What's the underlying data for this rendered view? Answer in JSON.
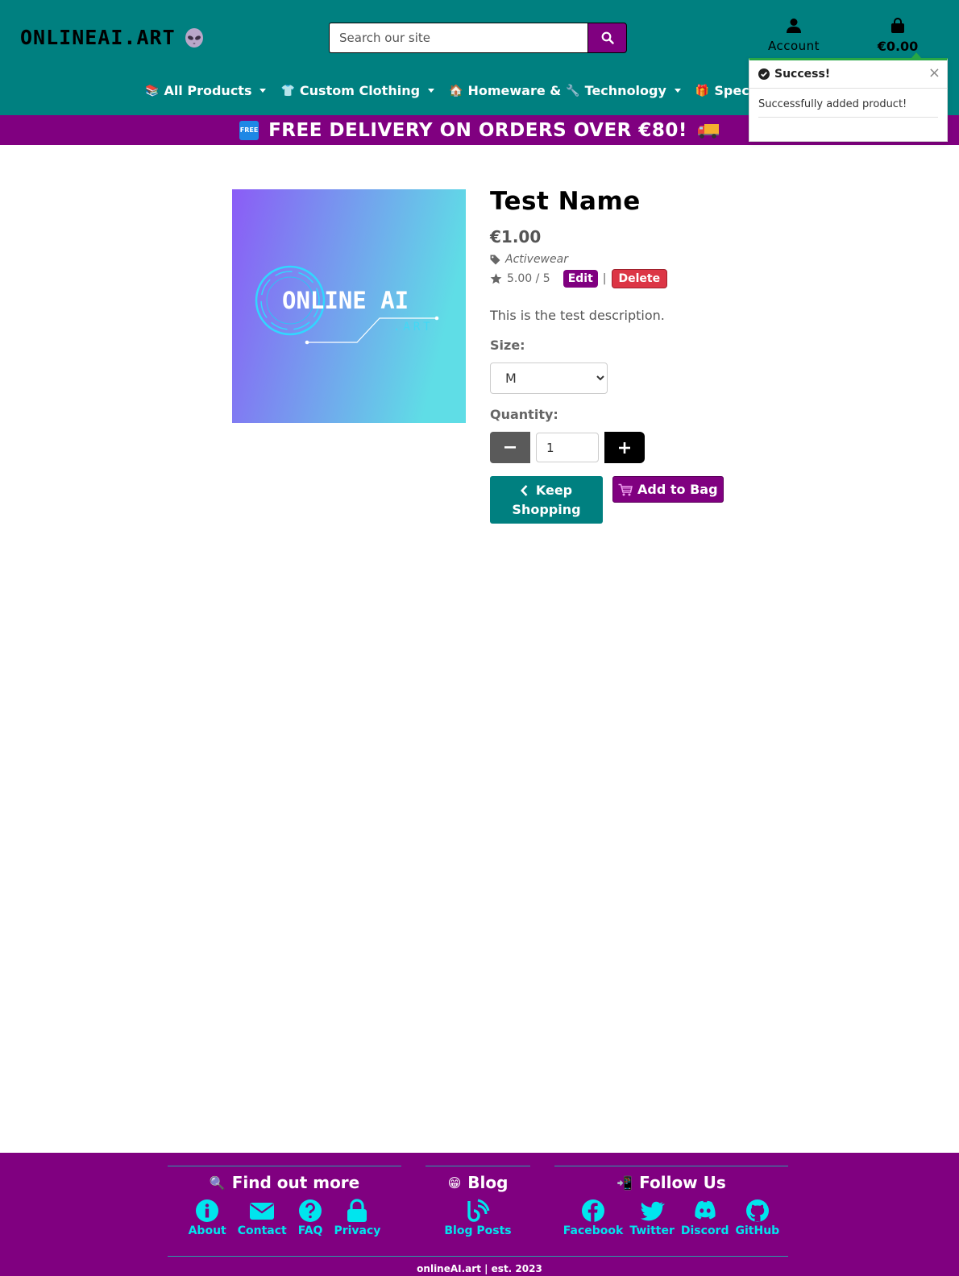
{
  "header": {
    "logo_text": "ONLINEAI.ART",
    "search_placeholder": "Search our site",
    "account_label": "Account",
    "cart_total": "€0.00"
  },
  "nav": {
    "items": [
      {
        "emoji": "📚",
        "label": "All Products"
      },
      {
        "emoji": "👕",
        "label": "Custom Clothing"
      },
      {
        "emoji": "🏠",
        "label": "Homeware &"
      },
      {
        "emoji": "🔧",
        "label": "Technology"
      },
      {
        "emoji": "🎁",
        "label": "Spec"
      }
    ]
  },
  "banner": {
    "badge": "FREE",
    "text": "FREE DELIVERY ON ORDERS OVER €80!"
  },
  "toast": {
    "title": "Success!",
    "close": "×",
    "message": "Successfully added product!"
  },
  "product": {
    "image_text": "ONLINE AI",
    "image_subtext": ".ART",
    "name": "Test Name",
    "price": "€1.00",
    "category": "Activewear",
    "rating": "5.00 / 5",
    "edit_label": "Edit",
    "separator": "|",
    "delete_label": "Delete",
    "description": "This is the test description.",
    "size_label": "Size:",
    "size_value": "M",
    "quantity_label": "Quantity:",
    "quantity_value": "1",
    "keep_line1": "Keep",
    "keep_line2": "Shopping",
    "add_label": "Add to Bag"
  },
  "footer": {
    "find": {
      "emoji": "🔍",
      "title": "Find out more",
      "links": [
        "About",
        "Contact",
        "FAQ",
        "Privacy"
      ]
    },
    "blog": {
      "emoji": "😁",
      "title": "Blog",
      "links": [
        "Blog",
        "Posts"
      ]
    },
    "follow": {
      "emoji": "📲",
      "title": "Follow Us",
      "links": [
        "Facebook",
        "Twitter",
        "Discord",
        "GitHub"
      ]
    },
    "copyright": "onlineAI.art | est. 2023"
  },
  "colors": {
    "teal": "#008080",
    "purple": "#800080",
    "footer_link": "#00e5ee",
    "danger": "#dc3545",
    "success": "#28a745"
  }
}
